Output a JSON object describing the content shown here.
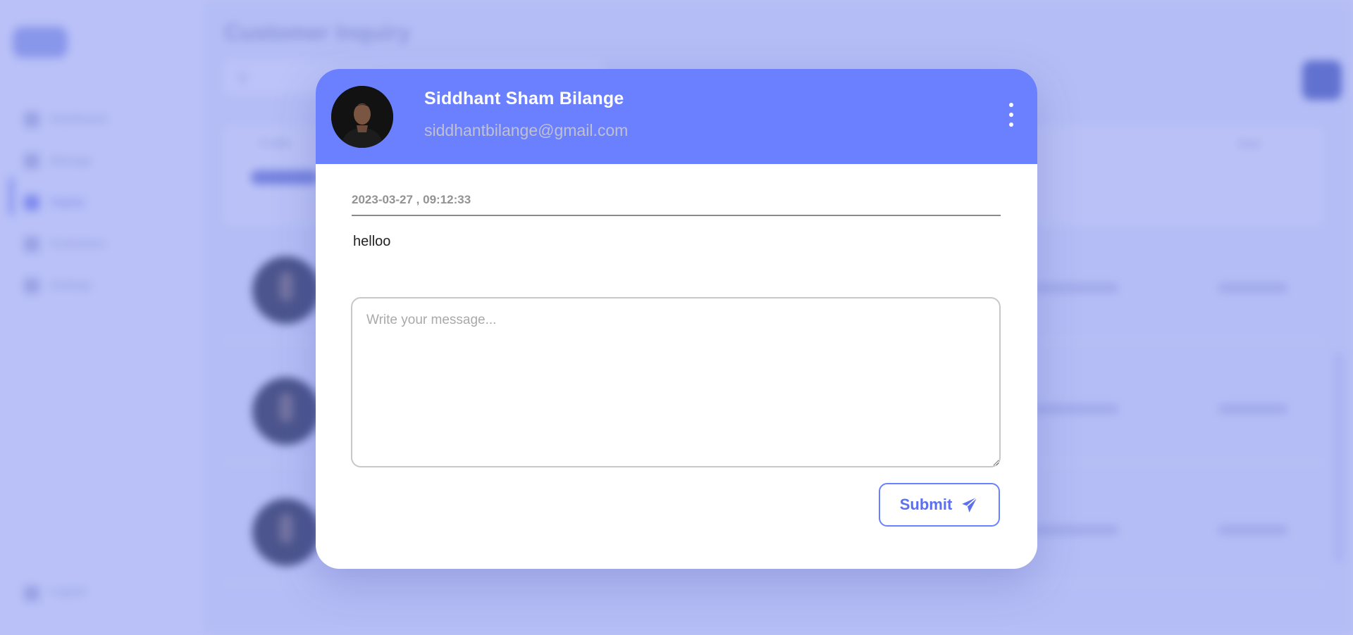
{
  "background": {
    "page_title": "Customer Inquiry",
    "search_placeholder": "Q",
    "nav_items": [
      "Dashboard",
      "Manage",
      "Inquiry",
      "Customers",
      "Settings"
    ],
    "logout_label": "Logout",
    "table_headers": {
      "left": "Profile",
      "right": "Date"
    }
  },
  "modal": {
    "user_name": "Siddhant Sham Bilange",
    "user_email": "siddhantbilange@gmail.com",
    "message_timestamp": "2023-03-27 , 09:12:33",
    "message_text": "helloo",
    "reply_placeholder": "Write your message...",
    "submit_label": "Submit",
    "icons": {
      "more": "kebab-menu-icon",
      "send": "paper-plane-icon"
    }
  },
  "colors": {
    "header_accent": "#6a80fe",
    "button_text": "#5b6ff0",
    "email_text": "#c1c0ce"
  }
}
